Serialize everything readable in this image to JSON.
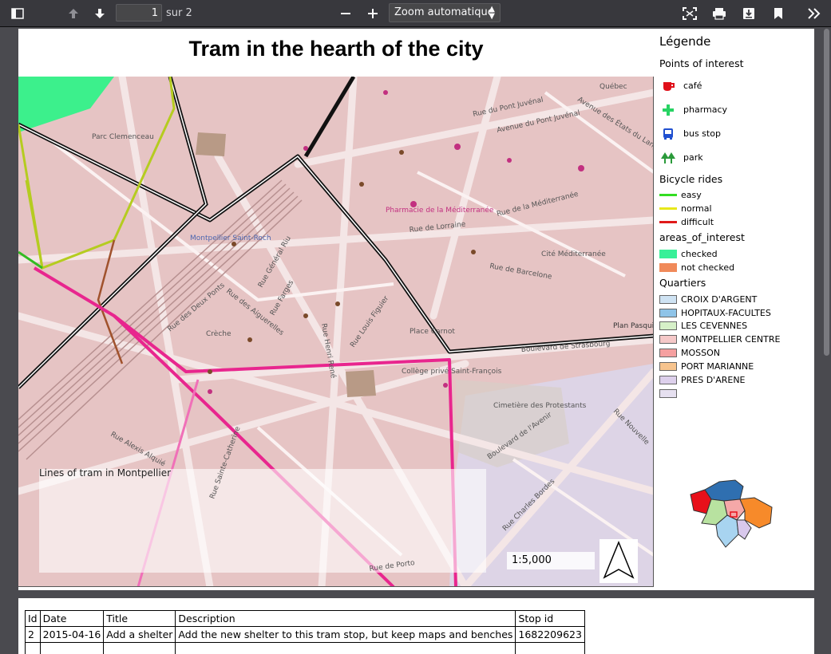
{
  "toolbar": {
    "page_current": "1",
    "page_count_text": "sur 2",
    "zoom_value": "Zoom automatique"
  },
  "layout": {
    "title": "Tram in the hearth of the city",
    "map_caption": "Lines of tram in Montpellier",
    "scale": "1:5,000"
  },
  "map_labels": [
    "Rue du Pont Juvénal",
    "Avenue du Pont Juvénal",
    "Avenue des États du Languedoc",
    "Rue de la Méditerranée",
    "Rue de Lorraine",
    "Rue de Barcelone",
    "Boulevard de Strasbourg",
    "Rue des Deux Ponts",
    "Rue Général Riu",
    "Rue Henri René",
    "Rue Louis Figuier",
    "Rue des Aiguerelles",
    "Rue Farges",
    "Rue Alexis Alquié",
    "Rue Sainte-Catherine",
    "Cimetière des Protestants",
    "Montpellier Saint-Roch",
    "Plan Pasquier",
    "Rue de Porto",
    "Boulevard de l'Avenir",
    "Rue Charles Bordes",
    "Rue Nouvelle",
    "Place Carnot",
    "Cité Méditerranée",
    "Collège privé Saint-François",
    "Pharmacie de la Méditerranée",
    "Crèche",
    "Québec",
    "Parc Clemenceau"
  ],
  "legend": {
    "title": "Légende",
    "groups": [
      {
        "title": "Points of interest",
        "items": [
          {
            "label": "café",
            "icon": "cafe-icon",
            "color": "#e0101a"
          },
          {
            "label": "pharmacy",
            "icon": "pharmacy-icon",
            "color": "#27d363"
          },
          {
            "label": "bus stop",
            "icon": "bus-stop-icon",
            "color": "#2050d0"
          },
          {
            "label": "park",
            "icon": "park-icon",
            "color": "#2a9a3a"
          }
        ]
      },
      {
        "title": "Bicycle rides",
        "items": [
          {
            "label": "easy",
            "color": "#33dd22"
          },
          {
            "label": "normal",
            "color": "#e8e81a"
          },
          {
            "label": "difficult",
            "color": "#e01a1a"
          }
        ]
      },
      {
        "title": "areas_of_interest",
        "items": [
          {
            "label": "checked",
            "color": "#38f098"
          },
          {
            "label": "not checked",
            "color": "#f08a5a"
          }
        ]
      },
      {
        "title": "Quartiers",
        "items": [
          {
            "label": "CROIX D'ARGENT",
            "color": "#cfe3f3"
          },
          {
            "label": "HOPITAUX-FACULTES",
            "color": "#8fc4e8"
          },
          {
            "label": "LES CEVENNES",
            "color": "#d6f0c8"
          },
          {
            "label": "MONTPELLIER CENTRE",
            "color": "#f5c8c8"
          },
          {
            "label": "MOSSON",
            "color": "#f5a0a0"
          },
          {
            "label": "PORT MARIANNE",
            "color": "#f7c48e"
          },
          {
            "label": "PRES D'ARENE",
            "color": "#ddd0ec"
          },
          {
            "label": "",
            "color": "#e6e0f0"
          }
        ]
      }
    ]
  },
  "table": {
    "headers": [
      "Id",
      "Date",
      "Title",
      "Description",
      "Stop id"
    ],
    "rows": [
      [
        "2",
        "2015-04-16",
        "Add a shelter",
        "Add the new shelter to this tram stop, but keep maps and benches",
        "1682209623"
      ]
    ]
  }
}
